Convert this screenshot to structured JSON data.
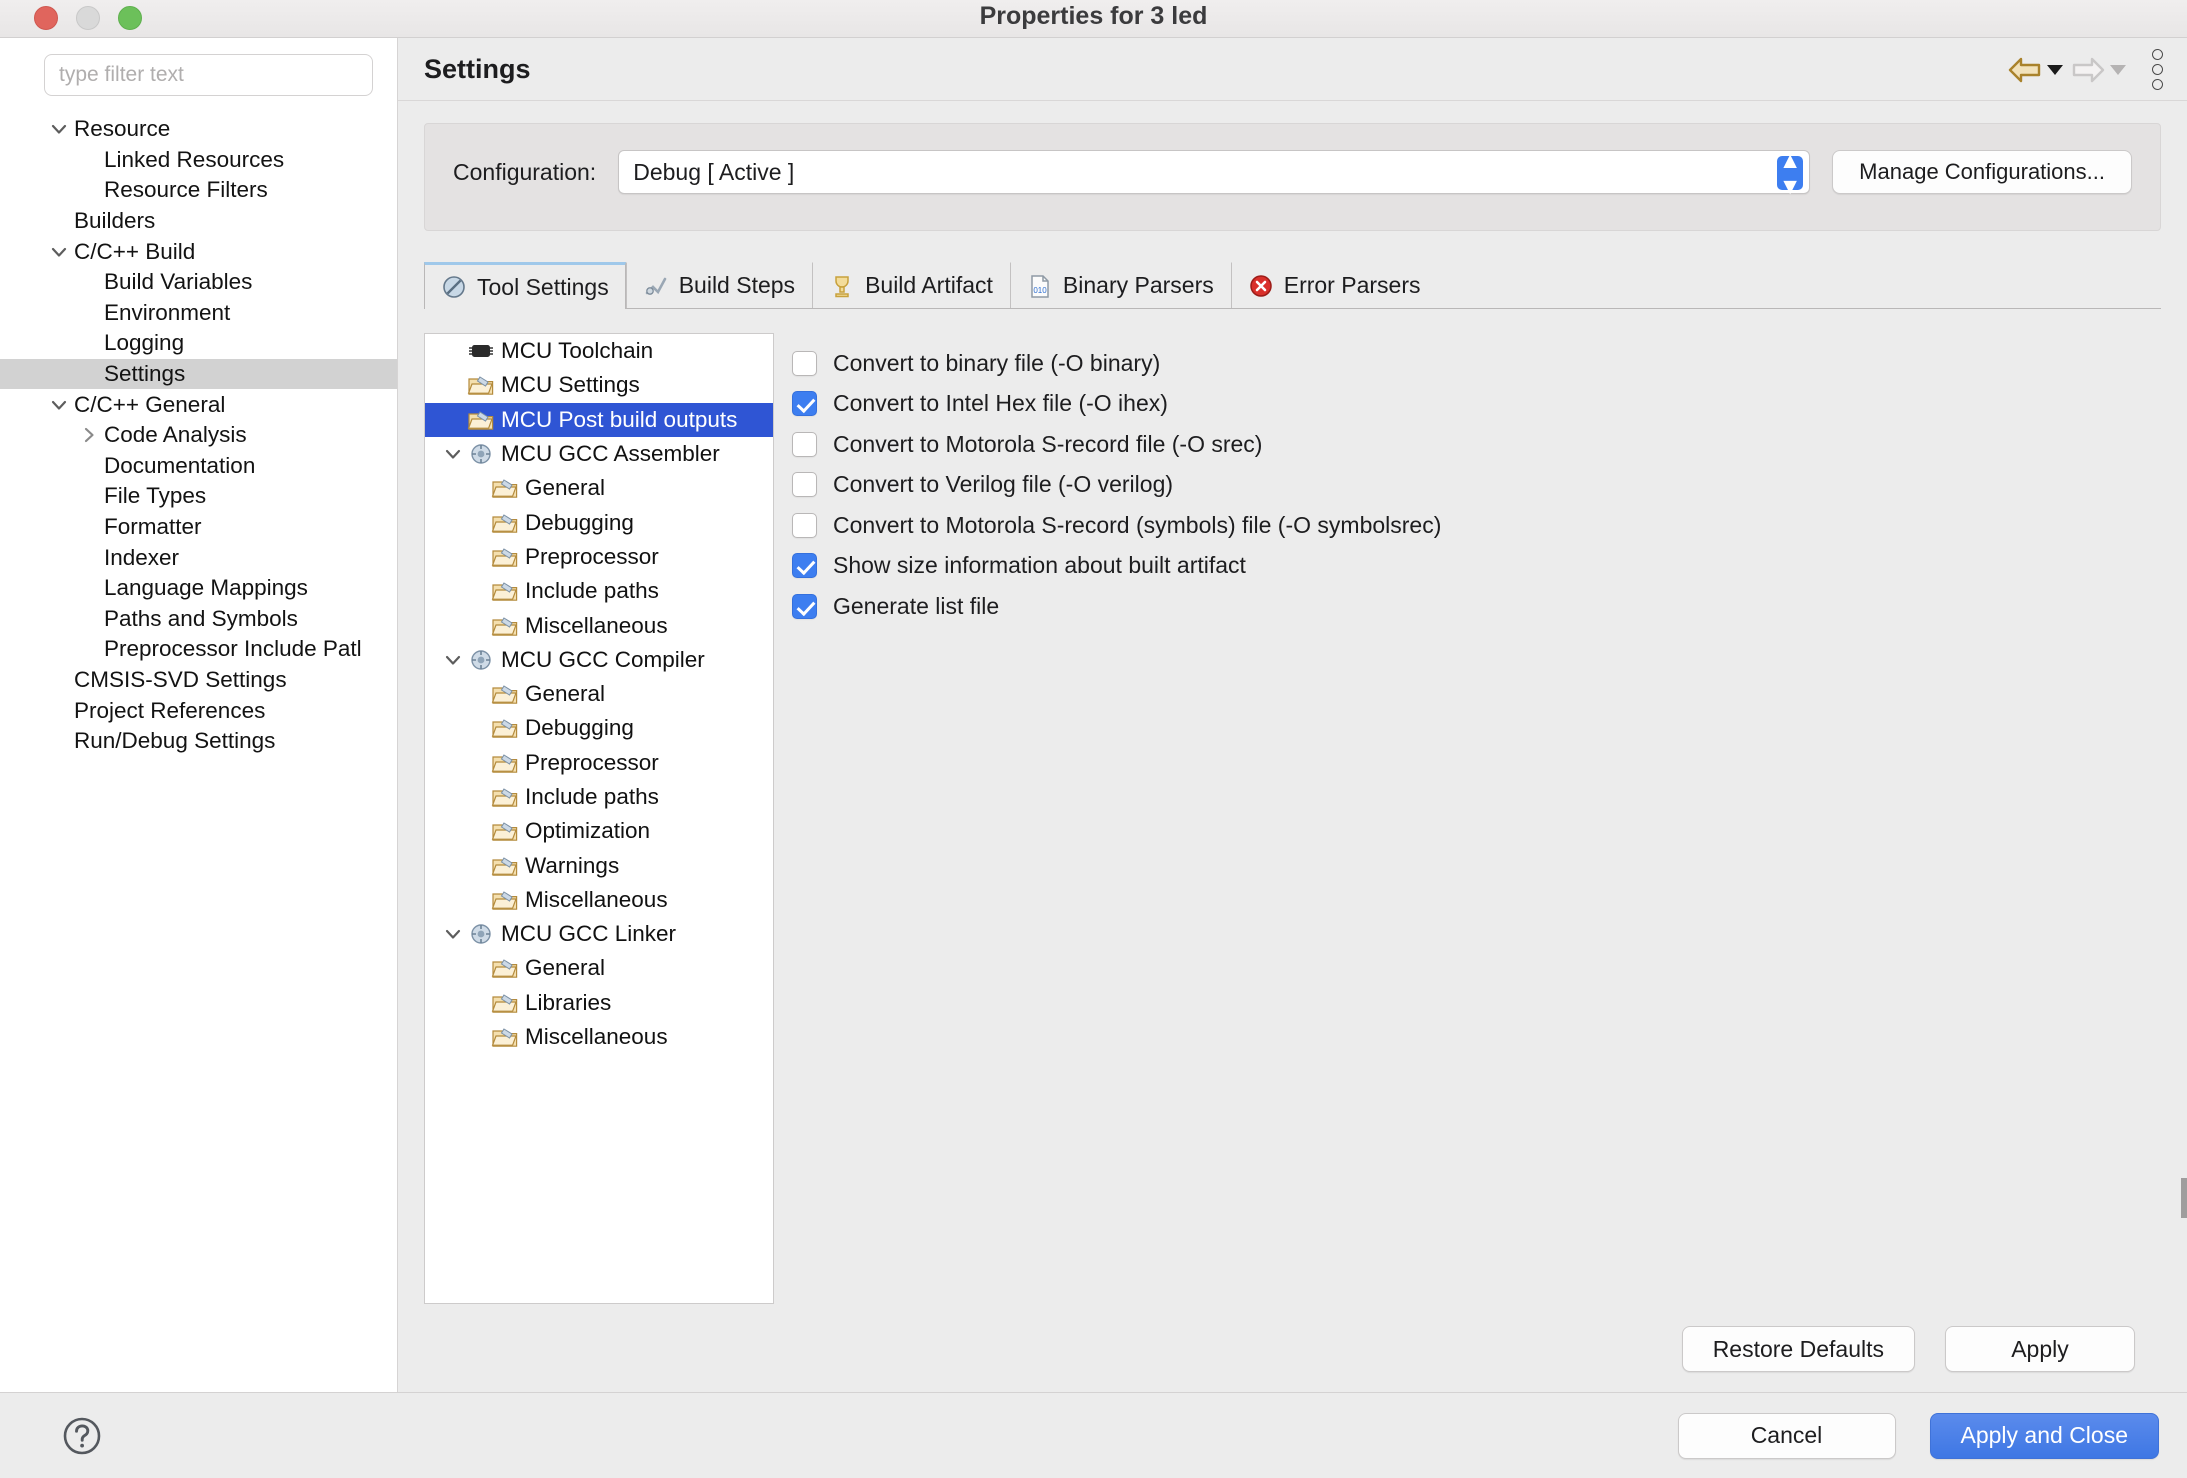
{
  "window": {
    "title": "Properties for 3 led",
    "traffic_lights": [
      "close",
      "minimize",
      "zoom"
    ]
  },
  "sidebar": {
    "filter": {
      "value": "",
      "placeholder": "type filter text"
    },
    "items": [
      {
        "label": "Resource",
        "indent": 0,
        "arrow": "down",
        "selected": false
      },
      {
        "label": "Linked Resources",
        "indent": 1,
        "arrow": "none",
        "selected": false
      },
      {
        "label": "Resource Filters",
        "indent": 1,
        "arrow": "none",
        "selected": false
      },
      {
        "label": "Builders",
        "indent": 0,
        "arrow": "none",
        "selected": false
      },
      {
        "label": "C/C++ Build",
        "indent": 0,
        "arrow": "down",
        "selected": false
      },
      {
        "label": "Build Variables",
        "indent": 1,
        "arrow": "none",
        "selected": false
      },
      {
        "label": "Environment",
        "indent": 1,
        "arrow": "none",
        "selected": false
      },
      {
        "label": "Logging",
        "indent": 1,
        "arrow": "none",
        "selected": false
      },
      {
        "label": "Settings",
        "indent": 1,
        "arrow": "none",
        "selected": true
      },
      {
        "label": "C/C++ General",
        "indent": 0,
        "arrow": "down",
        "selected": false
      },
      {
        "label": "Code Analysis",
        "indent": 1,
        "arrow": "right",
        "selected": false
      },
      {
        "label": "Documentation",
        "indent": 1,
        "arrow": "none",
        "selected": false
      },
      {
        "label": "File Types",
        "indent": 1,
        "arrow": "none",
        "selected": false
      },
      {
        "label": "Formatter",
        "indent": 1,
        "arrow": "none",
        "selected": false
      },
      {
        "label": "Indexer",
        "indent": 1,
        "arrow": "none",
        "selected": false
      },
      {
        "label": "Language Mappings",
        "indent": 1,
        "arrow": "none",
        "selected": false
      },
      {
        "label": "Paths and Symbols",
        "indent": 1,
        "arrow": "none",
        "selected": false
      },
      {
        "label": "Preprocessor Include Patl",
        "indent": 1,
        "arrow": "none",
        "selected": false
      },
      {
        "label": "CMSIS-SVD Settings",
        "indent": 0,
        "arrow": "none",
        "selected": false
      },
      {
        "label": "Project References",
        "indent": 0,
        "arrow": "none",
        "selected": false
      },
      {
        "label": "Run/Debug Settings",
        "indent": 0,
        "arrow": "none",
        "selected": false
      }
    ]
  },
  "header": {
    "title": "Settings",
    "back_icon": "back-arrow-icon",
    "forward_icon": "forward-arrow-icon",
    "menu_icon": "view-menu-icon"
  },
  "configuration": {
    "label": "Configuration:",
    "value": "Debug  [ Active ]",
    "manage_button": "Manage Configurations..."
  },
  "tabs": [
    {
      "label": "Tool Settings",
      "icon": "tool-settings-icon",
      "active": true
    },
    {
      "label": "Build Steps",
      "icon": "build-steps-icon",
      "active": false
    },
    {
      "label": "Build Artifact",
      "icon": "build-artifact-icon",
      "active": false
    },
    {
      "label": "Binary Parsers",
      "icon": "binary-parsers-icon",
      "active": false
    },
    {
      "label": "Error Parsers",
      "icon": "error-parsers-icon",
      "active": false
    }
  ],
  "tool_tree": [
    {
      "label": "MCU Toolchain",
      "indent": 0,
      "arrow": "none",
      "icon": "chip-icon",
      "selected": false
    },
    {
      "label": "MCU Settings",
      "indent": 0,
      "arrow": "none",
      "icon": "folder-icon",
      "selected": false
    },
    {
      "label": "MCU Post build outputs",
      "indent": 0,
      "arrow": "none",
      "icon": "folder-icon",
      "selected": true
    },
    {
      "label": "MCU GCC Assembler",
      "indent": 0,
      "arrow": "down",
      "icon": "gear-icon",
      "selected": false
    },
    {
      "label": "General",
      "indent": 1,
      "arrow": "none",
      "icon": "folder-icon",
      "selected": false
    },
    {
      "label": "Debugging",
      "indent": 1,
      "arrow": "none",
      "icon": "folder-icon",
      "selected": false
    },
    {
      "label": "Preprocessor",
      "indent": 1,
      "arrow": "none",
      "icon": "folder-icon",
      "selected": false
    },
    {
      "label": "Include paths",
      "indent": 1,
      "arrow": "none",
      "icon": "folder-icon",
      "selected": false
    },
    {
      "label": "Miscellaneous",
      "indent": 1,
      "arrow": "none",
      "icon": "folder-icon",
      "selected": false
    },
    {
      "label": "MCU GCC Compiler",
      "indent": 0,
      "arrow": "down",
      "icon": "gear-icon",
      "selected": false
    },
    {
      "label": "General",
      "indent": 1,
      "arrow": "none",
      "icon": "folder-icon",
      "selected": false
    },
    {
      "label": "Debugging",
      "indent": 1,
      "arrow": "none",
      "icon": "folder-icon",
      "selected": false
    },
    {
      "label": "Preprocessor",
      "indent": 1,
      "arrow": "none",
      "icon": "folder-icon",
      "selected": false
    },
    {
      "label": "Include paths",
      "indent": 1,
      "arrow": "none",
      "icon": "folder-icon",
      "selected": false
    },
    {
      "label": "Optimization",
      "indent": 1,
      "arrow": "none",
      "icon": "folder-icon",
      "selected": false
    },
    {
      "label": "Warnings",
      "indent": 1,
      "arrow": "none",
      "icon": "folder-icon",
      "selected": false
    },
    {
      "label": "Miscellaneous",
      "indent": 1,
      "arrow": "none",
      "icon": "folder-icon",
      "selected": false
    },
    {
      "label": "MCU GCC Linker",
      "indent": 0,
      "arrow": "down",
      "icon": "gear-icon",
      "selected": false
    },
    {
      "label": "General",
      "indent": 1,
      "arrow": "none",
      "icon": "folder-icon",
      "selected": false
    },
    {
      "label": "Libraries",
      "indent": 1,
      "arrow": "none",
      "icon": "folder-icon",
      "selected": false
    },
    {
      "label": "Miscellaneous",
      "indent": 1,
      "arrow": "none",
      "icon": "folder-icon",
      "selected": false
    }
  ],
  "options": [
    {
      "label": "Convert to binary file (-O binary)",
      "checked": false
    },
    {
      "label": "Convert to Intel Hex file (-O ihex)",
      "checked": true
    },
    {
      "label": "Convert to Motorola S-record file (-O srec)",
      "checked": false
    },
    {
      "label": "Convert to Verilog file (-O verilog)",
      "checked": false
    },
    {
      "label": "Convert to Motorola S-record (symbols) file (-O symbolsrec)",
      "checked": false
    },
    {
      "label": "Show size information about built artifact",
      "checked": true
    },
    {
      "label": "Generate list file",
      "checked": true
    }
  ],
  "actions": {
    "restore_defaults": "Restore Defaults",
    "apply": "Apply",
    "cancel": "Cancel",
    "apply_and_close": "Apply and Close",
    "help_icon": "help-icon"
  },
  "colors": {
    "accent_blue": "#4a7fe8",
    "selection_blue": "#2f55d4",
    "checkbox_blue": "#3d7ef0",
    "tab_active_top": "#9fc8ea",
    "window_bg": "#ececec",
    "sidebar_selection": "#d2d2d2"
  }
}
